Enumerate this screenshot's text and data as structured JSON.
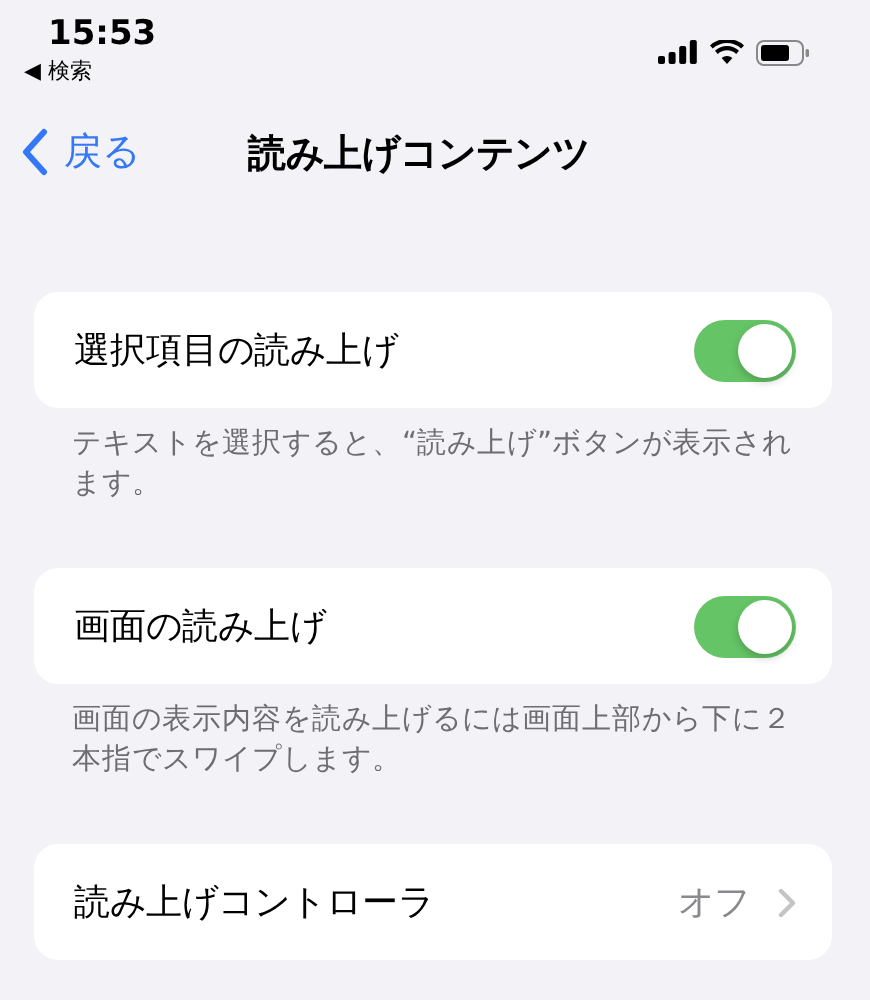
{
  "status_bar": {
    "time": "15:53",
    "back_app": "◀ 検索"
  },
  "nav": {
    "back_label": "戻る",
    "title": "読み上げコンテンツ"
  },
  "groups": [
    {
      "kind": "toggle",
      "label": "選択項目の読み上げ",
      "on": true,
      "footer": "テキストを選択すると、“読み上げ”ボタンが表示されます。"
    },
    {
      "kind": "toggle",
      "label": "画面の読み上げ",
      "on": true,
      "footer": "画面の表示内容を読み上げるには画面上部から下に２本指でスワイプします。"
    },
    {
      "kind": "disclosure",
      "label": "読み上げコントローラ",
      "value": "オフ"
    }
  ]
}
